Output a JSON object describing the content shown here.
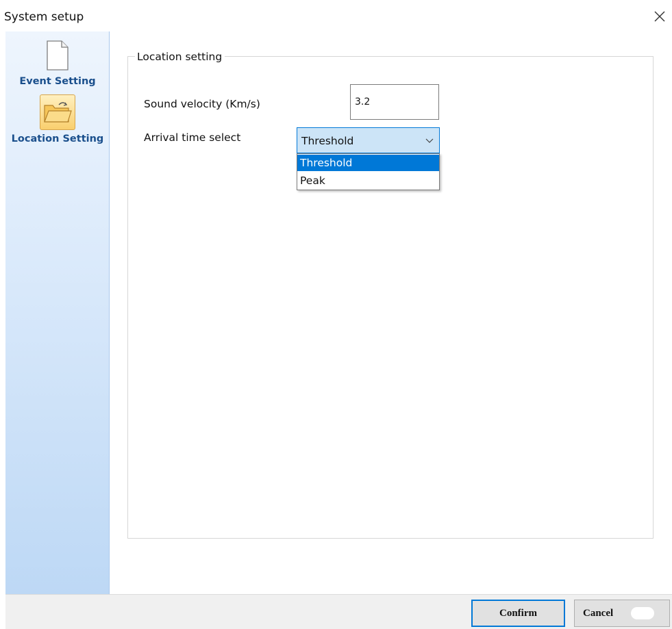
{
  "window": {
    "title": "System setup",
    "close_icon": "close-icon"
  },
  "sidebar": {
    "items": [
      {
        "label": "Event Setting",
        "icon": "document-icon"
      },
      {
        "label": "Location Setting",
        "icon": "folder-open-icon",
        "selected": true
      }
    ]
  },
  "location": {
    "group_title": "Location setting",
    "velocity_label": "Sound velocity (Km/s)",
    "velocity_value": "3.2",
    "arrival_label": "Arrival time select",
    "arrival_selected": "Threshold",
    "arrival_options": [
      "Threshold",
      "Peak"
    ],
    "highlighted_option": "Threshold"
  },
  "footer": {
    "confirm_label": "Confirm",
    "cancel_label": "Cancel"
  },
  "colors": {
    "accent": "#0078d7",
    "sidebar_text": "#1a4f8c",
    "select_bg": "#cce4f7"
  }
}
